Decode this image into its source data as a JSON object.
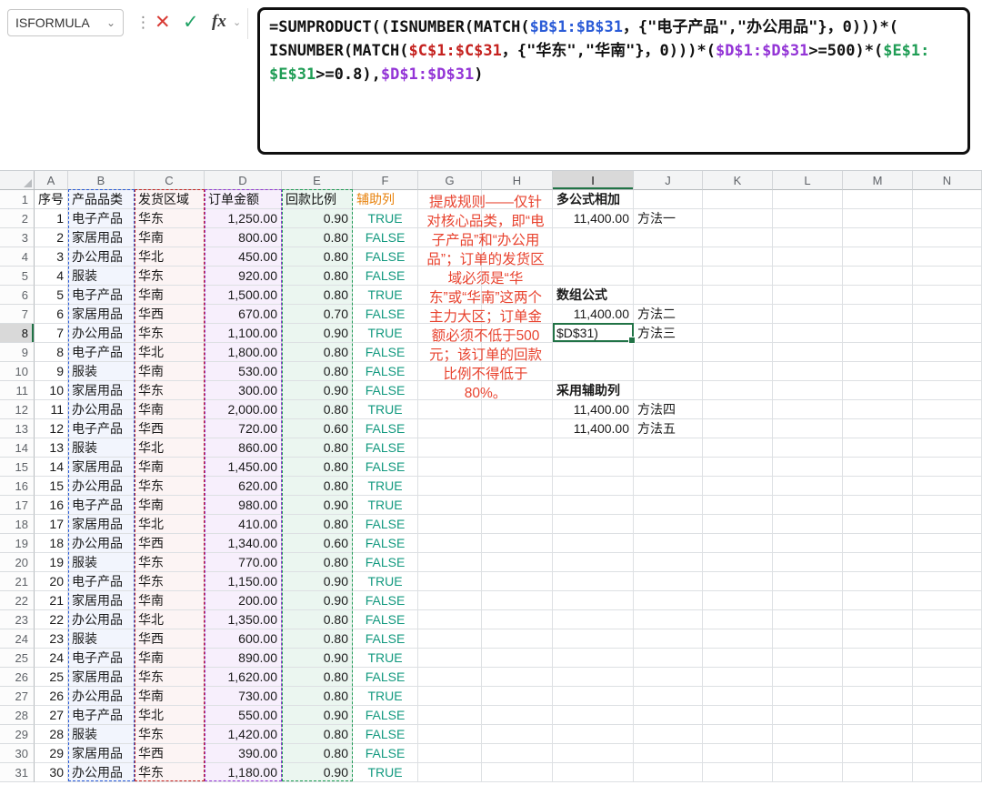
{
  "formula_bar": {
    "name_box": "ISFORMULA",
    "cancel_label": "✕",
    "confirm_label": "✓",
    "insert_function_label": "fx",
    "formula_segments": [
      {
        "text": "=SUMPRODUCT((ISNUMBER(MATCH(",
        "color": "default"
      },
      {
        "text": "$B$1:$B$31",
        "color": "blue"
      },
      {
        "text": "，{\"电子产品\",\"办公用品\"}，0)))*(\nISNUMBER(MATCH(",
        "color": "default"
      },
      {
        "text": "$C$1:$C$31",
        "color": "red"
      },
      {
        "text": "，{\"华东\",\"华南\"}，0)))*(",
        "color": "default"
      },
      {
        "text": "$D$1:$D$31",
        "color": "purple"
      },
      {
        "text": ">=500)*(",
        "color": "default"
      },
      {
        "text": "$E$1:\n$E$31",
        "color": "green"
      },
      {
        "text": ">=0.8),",
        "color": "default"
      },
      {
        "text": "$D$1:$D$31",
        "color": "purple"
      },
      {
        "text": ")",
        "color": "default"
      }
    ]
  },
  "sheet": {
    "column_letters": [
      "A",
      "B",
      "C",
      "D",
      "E",
      "F",
      "G",
      "H",
      "I",
      "J",
      "K",
      "L",
      "M",
      "N"
    ],
    "row_count": 31,
    "selected_column": "I",
    "selected_row": 8,
    "headers": {
      "A": "序号",
      "B": "产品品类",
      "C": "发货区域",
      "D": "订单金额",
      "E": "回款比例",
      "F": "辅助列"
    },
    "rows": [
      [
        "1",
        "电子产品",
        "华东",
        "1,250.00",
        "0.90",
        "TRUE"
      ],
      [
        "2",
        "家居用品",
        "华南",
        "800.00",
        "0.80",
        "FALSE"
      ],
      [
        "3",
        "办公用品",
        "华北",
        "450.00",
        "0.80",
        "FALSE"
      ],
      [
        "4",
        "服装",
        "华东",
        "920.00",
        "0.80",
        "FALSE"
      ],
      [
        "5",
        "电子产品",
        "华南",
        "1,500.00",
        "0.80",
        "TRUE"
      ],
      [
        "6",
        "家居用品",
        "华西",
        "670.00",
        "0.70",
        "FALSE"
      ],
      [
        "7",
        "办公用品",
        "华东",
        "1,100.00",
        "0.90",
        "TRUE"
      ],
      [
        "8",
        "电子产品",
        "华北",
        "1,800.00",
        "0.80",
        "FALSE"
      ],
      [
        "9",
        "服装",
        "华南",
        "530.00",
        "0.80",
        "FALSE"
      ],
      [
        "10",
        "家居用品",
        "华东",
        "300.00",
        "0.90",
        "FALSE"
      ],
      [
        "11",
        "办公用品",
        "华南",
        "2,000.00",
        "0.80",
        "TRUE"
      ],
      [
        "12",
        "电子产品",
        "华西",
        "720.00",
        "0.60",
        "FALSE"
      ],
      [
        "13",
        "服装",
        "华北",
        "860.00",
        "0.80",
        "FALSE"
      ],
      [
        "14",
        "家居用品",
        "华南",
        "1,450.00",
        "0.80",
        "FALSE"
      ],
      [
        "15",
        "办公用品",
        "华东",
        "620.00",
        "0.80",
        "TRUE"
      ],
      [
        "16",
        "电子产品",
        "华南",
        "980.00",
        "0.90",
        "TRUE"
      ],
      [
        "17",
        "家居用品",
        "华北",
        "410.00",
        "0.80",
        "FALSE"
      ],
      [
        "18",
        "办公用品",
        "华西",
        "1,340.00",
        "0.60",
        "FALSE"
      ],
      [
        "19",
        "服装",
        "华东",
        "770.00",
        "0.80",
        "FALSE"
      ],
      [
        "20",
        "电子产品",
        "华东",
        "1,150.00",
        "0.90",
        "TRUE"
      ],
      [
        "21",
        "家居用品",
        "华南",
        "200.00",
        "0.90",
        "FALSE"
      ],
      [
        "22",
        "办公用品",
        "华北",
        "1,350.00",
        "0.80",
        "FALSE"
      ],
      [
        "23",
        "服装",
        "华西",
        "600.00",
        "0.80",
        "FALSE"
      ],
      [
        "24",
        "电子产品",
        "华南",
        "890.00",
        "0.90",
        "TRUE"
      ],
      [
        "25",
        "家居用品",
        "华东",
        "1,620.00",
        "0.80",
        "FALSE"
      ],
      [
        "26",
        "办公用品",
        "华南",
        "730.00",
        "0.80",
        "TRUE"
      ],
      [
        "27",
        "电子产品",
        "华北",
        "550.00",
        "0.90",
        "FALSE"
      ],
      [
        "28",
        "服装",
        "华东",
        "1,420.00",
        "0.80",
        "FALSE"
      ],
      [
        "29",
        "家居用品",
        "华西",
        "390.00",
        "0.80",
        "FALSE"
      ],
      [
        "30",
        "办公用品",
        "华东",
        "1,180.00",
        "0.90",
        "TRUE"
      ]
    ],
    "side_cells": [
      {
        "col": "I",
        "row": 1,
        "text": "多公式相加",
        "style": "bold"
      },
      {
        "col": "I",
        "row": 2,
        "text": "11,400.00",
        "style": "num"
      },
      {
        "col": "J",
        "row": 2,
        "text": "方法一",
        "style": "txt"
      },
      {
        "col": "I",
        "row": 6,
        "text": "数组公式",
        "style": "bold"
      },
      {
        "col": "I",
        "row": 7,
        "text": "11,400.00",
        "style": "num"
      },
      {
        "col": "J",
        "row": 7,
        "text": "方法二",
        "style": "txt"
      },
      {
        "col": "I",
        "row": 8,
        "text": "$D$31)",
        "style": "txt"
      },
      {
        "col": "J",
        "row": 8,
        "text": "方法三",
        "style": "txt"
      },
      {
        "col": "I",
        "row": 11,
        "text": "采用辅助列",
        "style": "bold"
      },
      {
        "col": "I",
        "row": 12,
        "text": "11,400.00",
        "style": "num"
      },
      {
        "col": "J",
        "row": 12,
        "text": "方法四",
        "style": "txt"
      },
      {
        "col": "I",
        "row": 13,
        "text": "11,400.00",
        "style": "num"
      },
      {
        "col": "J",
        "row": 13,
        "text": "方法五",
        "style": "txt"
      }
    ],
    "annotation": "提成规则——仅针对核心品类，即“电子产品”和“办公用品”；订单的发货区域必须是“华东”或“华南”这两个主力大区；订单金额必须不低于500元；该订单的回款比例不得低于80%。",
    "range_highlights": [
      {
        "column": "B",
        "color": "#2a5bd7",
        "fill": "rgba(42,91,215,0.06)"
      },
      {
        "column": "C",
        "color": "#c5221f",
        "fill": "rgba(197,34,31,0.05)"
      },
      {
        "column": "D",
        "color": "#9334d6",
        "fill": "rgba(147,52,214,0.08)"
      },
      {
        "column": "E",
        "color": "#1f9d55",
        "fill": "rgba(31,157,85,0.09)"
      }
    ]
  },
  "colors": {
    "selection_green": "#217346",
    "range_b_blue": "#2a5bd7",
    "range_c_red": "#c5221f",
    "range_d_purple": "#9334d6",
    "range_e_green": "#1f9d55",
    "boolean_teal": "#12997f",
    "helper_header_orange": "#e8820c",
    "annotation_red": "#e8432f",
    "formula_default": "#111111"
  }
}
